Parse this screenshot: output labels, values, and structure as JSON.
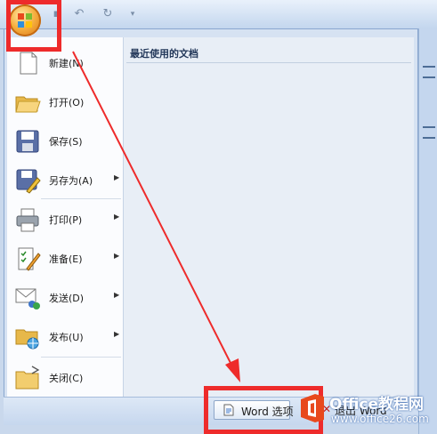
{
  "menu_items": [
    {
      "label": "新建(N)",
      "has_arrow": false,
      "icon": "new-document-icon"
    },
    {
      "label": "打开(O)",
      "has_arrow": false,
      "icon": "folder-open-icon"
    },
    {
      "label": "保存(S)",
      "has_arrow": false,
      "icon": "save-icon"
    },
    {
      "label": "另存为(A)",
      "has_arrow": true,
      "icon": "save-as-icon"
    },
    {
      "label": "打印(P)",
      "has_arrow": true,
      "icon": "printer-icon"
    },
    {
      "label": "准备(E)",
      "has_arrow": true,
      "icon": "prepare-icon"
    },
    {
      "label": "发送(D)",
      "has_arrow": true,
      "icon": "send-icon"
    },
    {
      "label": "发布(U)",
      "has_arrow": true,
      "icon": "publish-icon"
    },
    {
      "label": "关闭(C)",
      "has_arrow": false,
      "icon": "close-folder-icon"
    }
  ],
  "recent_documents": {
    "title": "最近使用的文档"
  },
  "bottom": {
    "word_options_label": "Word 选项",
    "exit_label": "退出 Word"
  },
  "watermark": {
    "brand": "Office教程网",
    "url": "www.office26.com"
  },
  "colors": {
    "annotation": "#ee2b2b",
    "office_orange": "#f6b040",
    "frame": "#d6e2f2"
  }
}
